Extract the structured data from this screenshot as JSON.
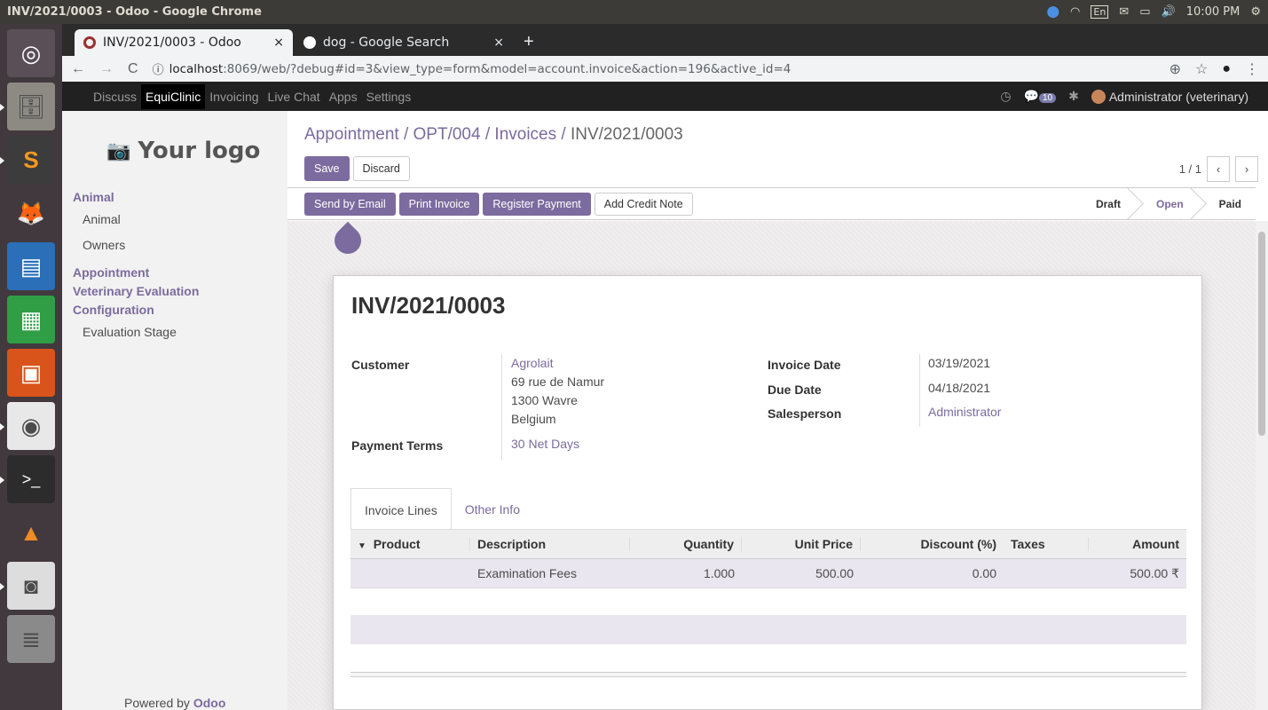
{
  "os": {
    "window_title": "INV/2021/0003 - Odoo - Google Chrome",
    "keyboard": "En",
    "clock": "10:00 PM"
  },
  "browser": {
    "tabs": [
      {
        "title": "INV/2021/0003 - Odoo",
        "favicon_color": "#9b2f2f"
      },
      {
        "title": "dog - Google Search",
        "favicon_color": "#4285f4"
      }
    ],
    "url_host": "localhost",
    "url_rest": ":8069/web/?debug#id=3&view_type=form&model=account.invoice&action=196&active_id=4"
  },
  "navbar": {
    "menus": [
      "Discuss",
      "EquiClinic",
      "Invoicing",
      "Live Chat",
      "Apps",
      "Settings"
    ],
    "messages_count": "10",
    "user": "Administrator (veterinary)"
  },
  "sidebar": {
    "logo": "Your logo",
    "sections": [
      {
        "title": "Animal",
        "items": [
          "Animal",
          "Owners"
        ]
      },
      {
        "title": "Appointment",
        "items": []
      },
      {
        "title": "Veterinary Evaluation",
        "items": []
      },
      {
        "title": "Configuration",
        "items": [
          "Evaluation Stage"
        ]
      }
    ],
    "powered_prefix": "Powered by ",
    "powered_brand": "Odoo"
  },
  "breadcrumb": [
    "Appointment",
    "OPT/004",
    "Invoices",
    "INV/2021/0003"
  ],
  "buttons": {
    "save": "Save",
    "discard": "Discard",
    "send_email": "Send by Email",
    "print": "Print Invoice",
    "register_payment": "Register Payment",
    "credit_note": "Add Credit Note"
  },
  "pager": "1 / 1",
  "stages": [
    "Draft",
    "Open",
    "Paid"
  ],
  "current_stage": "Open",
  "invoice": {
    "number": "INV/2021/0003",
    "customer_label": "Customer",
    "customer_name": "Agrolait",
    "address": [
      "69 rue de Namur",
      "1300 Wavre",
      "Belgium"
    ],
    "payment_terms_label": "Payment Terms",
    "payment_terms": "30 Net Days",
    "invoice_date_label": "Invoice Date",
    "invoice_date": "03/19/2021",
    "due_date_label": "Due Date",
    "due_date": "04/18/2021",
    "salesperson_label": "Salesperson",
    "salesperson": "Administrator"
  },
  "form_tabs": [
    "Invoice Lines",
    "Other Info"
  ],
  "lines": {
    "columns": [
      "Product",
      "Description",
      "Quantity",
      "Unit Price",
      "Discount (%)",
      "Taxes",
      "Amount"
    ],
    "rows": [
      {
        "product": "",
        "description": "Examination Fees",
        "quantity": "1.000",
        "unit_price": "500.00",
        "discount": "0.00",
        "taxes": "",
        "amount": "500.00 ₹"
      }
    ]
  }
}
